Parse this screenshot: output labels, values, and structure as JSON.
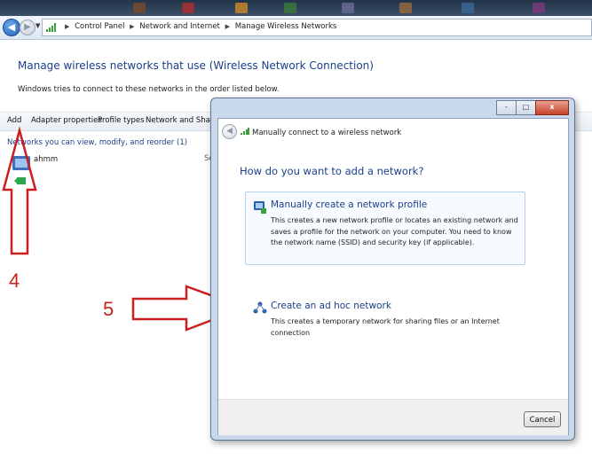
{
  "breadcrumb": {
    "items": [
      "Control Panel",
      "Network and Internet",
      "Manage Wireless Networks"
    ]
  },
  "header": {
    "title": "Manage wireless networks that use (Wireless Network Connection)",
    "subtitle": "Windows tries to connect to these networks in the order listed below."
  },
  "toolbar": {
    "add": "Add",
    "adapter_properties": "Adapter properties",
    "profile_types": "Profile types",
    "network_sharing": "Network and Sharing"
  },
  "list": {
    "group_label": "Networks you can view, modify, and reorder (1)",
    "items": [
      {
        "name": "ahmm",
        "security": "Se"
      }
    ]
  },
  "annotations": {
    "step_4": "4",
    "step_5": "5",
    "color": "#cc1f1f"
  },
  "dialog": {
    "title": "Manually connect to a wireless network",
    "question": "How do you want to add a network?",
    "options": [
      {
        "title": "Manually create a network profile",
        "description": "This creates a new network profile or locates an existing network and saves a profile for the network on your computer. You need to know the network name (SSID) and security key (if applicable)."
      },
      {
        "title": "Create an ad hoc network",
        "description": "This creates a temporary network for sharing files or an Internet connection"
      }
    ],
    "cancel_label": "Cancel",
    "close_glyph": "x",
    "minimize_glyph": "-",
    "maximize_glyph": "□"
  },
  "colors": {
    "link_blue": "#1a3f8c",
    "arrow_red": "#cc1f1f"
  }
}
